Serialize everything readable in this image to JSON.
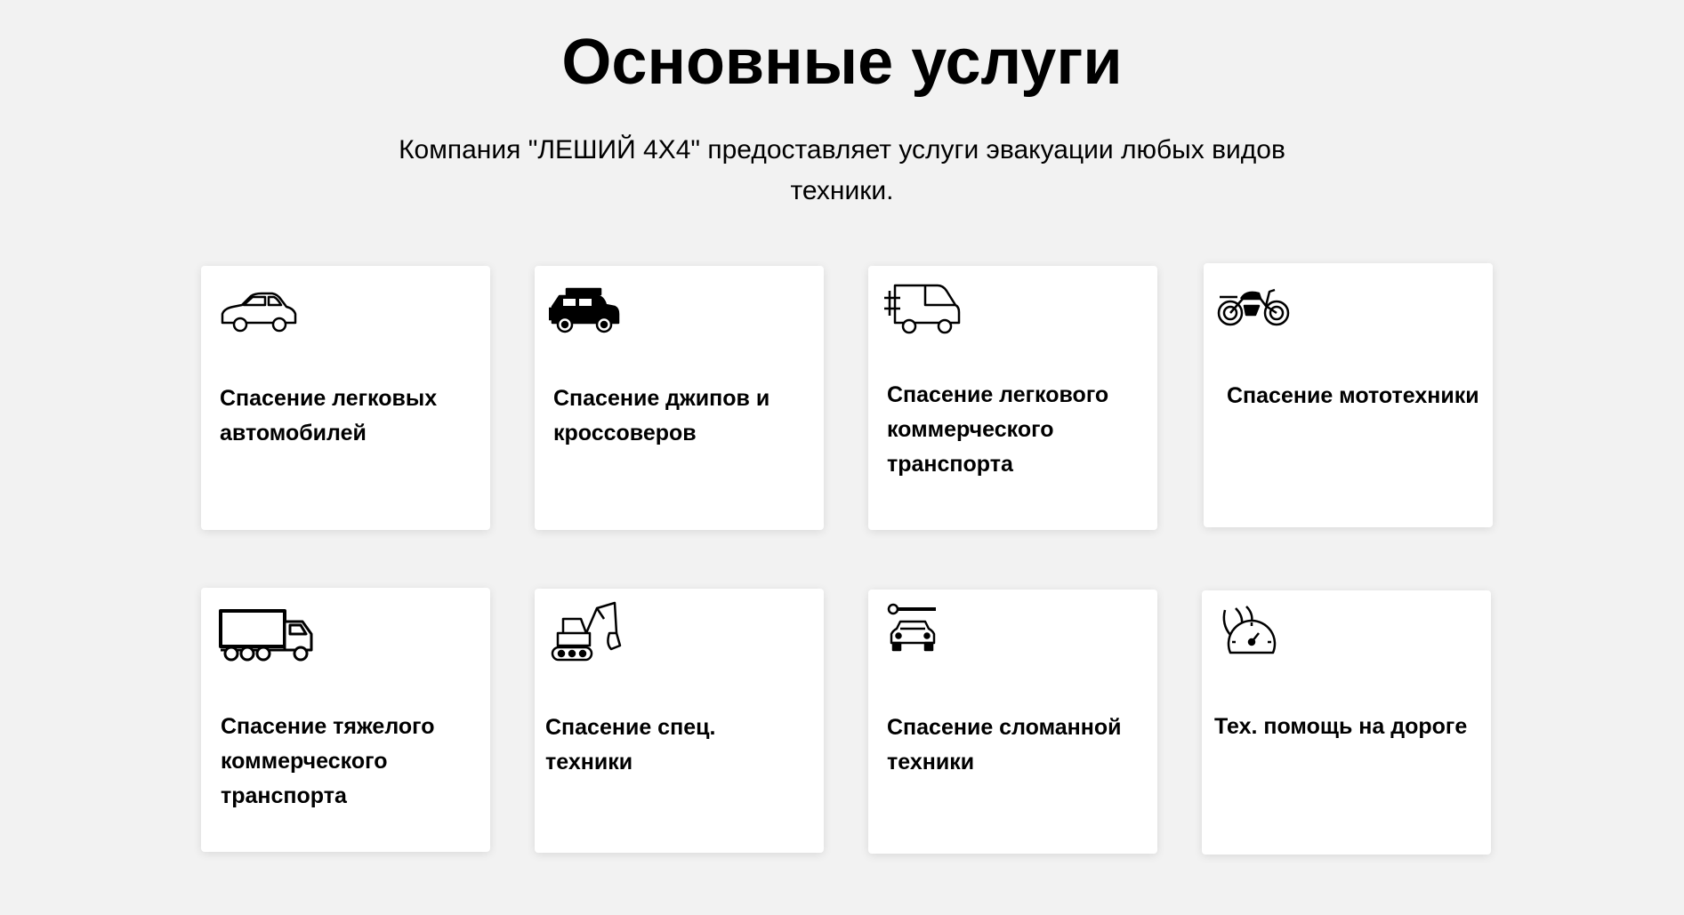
{
  "section": {
    "title": "Основные услуги",
    "subtitle": "Компания \"ЛЕШИЙ 4Х4\" предоставляет услуги эвакуации любых видов техники."
  },
  "services": [
    {
      "label": "Спасение легковых автомобилей",
      "icon": "car-icon"
    },
    {
      "label": "Спасение джипов и кроссоверов",
      "icon": "jeep-icon"
    },
    {
      "label": "Спасение легкового коммерческого транспорта",
      "icon": "van-icon"
    },
    {
      "label": "Спасение мототехники",
      "icon": "motorcycle-icon"
    },
    {
      "label": "Спасение тяжелого коммерческого транспорта",
      "icon": "truck-icon"
    },
    {
      "label": "Спасение спец. техники",
      "icon": "excavator-icon"
    },
    {
      "label": "Спасение сломанной техники",
      "icon": "broken-car-wrench-icon"
    },
    {
      "label": "Тех. помощь на дороге",
      "icon": "road-assistance-icon"
    }
  ]
}
